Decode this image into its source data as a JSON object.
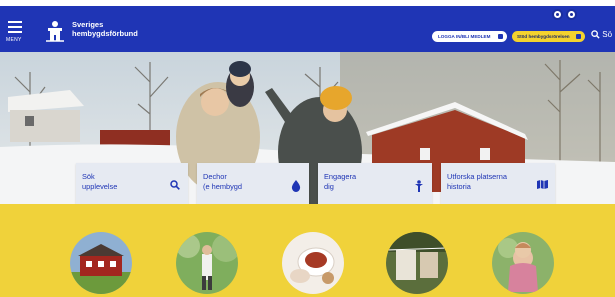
{
  "header": {
    "menu_label": "MENY",
    "brand_line1": "Sveriges",
    "brand_line2": "hembygdsförbund",
    "login_label": "LOGGA IN/BLI MEDLEM",
    "support_label": "Stöd hembygdsrörelsen",
    "search_label": "Sö"
  },
  "cards": [
    {
      "line1": "Sök",
      "line2": "upplevelse"
    },
    {
      "line1": "Dechor",
      "line2": "(e hembygd"
    },
    {
      "line1": "Engagera",
      "line2": "dig"
    },
    {
      "line1": "Utforska platserna",
      "line2": "historia"
    }
  ],
  "colors": {
    "header_blue": "#1f35b5",
    "accent_yellow": "#f0d23a",
    "card_bg": "#e6eaf2"
  },
  "icons": {
    "card_1": "search-icon",
    "card_2": "drop-icon",
    "card_3": "person-icon",
    "card_4": "map-icon"
  }
}
